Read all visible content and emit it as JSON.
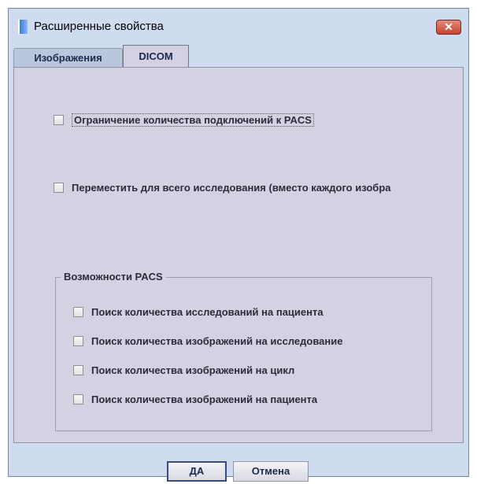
{
  "window": {
    "title": "Расширенные свойства",
    "close_symbol": "✕"
  },
  "tabs": [
    {
      "label": "Изображения",
      "active": false
    },
    {
      "label": "DICOM",
      "active": true
    }
  ],
  "options": {
    "limit_connections": {
      "label": "Ограничение количества подключений к PACS",
      "checked": false
    },
    "move_whole_study": {
      "label": "Переместить для всего исследования (вместо каждого изобра",
      "checked": false
    }
  },
  "pacs_group": {
    "title": "Возможности PACS",
    "items": [
      {
        "label": "Поиск количества исследований на пациента",
        "checked": false
      },
      {
        "label": "Поиск количества изображений на исследование",
        "checked": false
      },
      {
        "label": "Поиск количества изображений на цикл",
        "checked": false
      },
      {
        "label": "Поиск количества изображений на пациента",
        "checked": false
      }
    ]
  },
  "buttons": {
    "ok": "ДА",
    "cancel": "Отмена"
  }
}
